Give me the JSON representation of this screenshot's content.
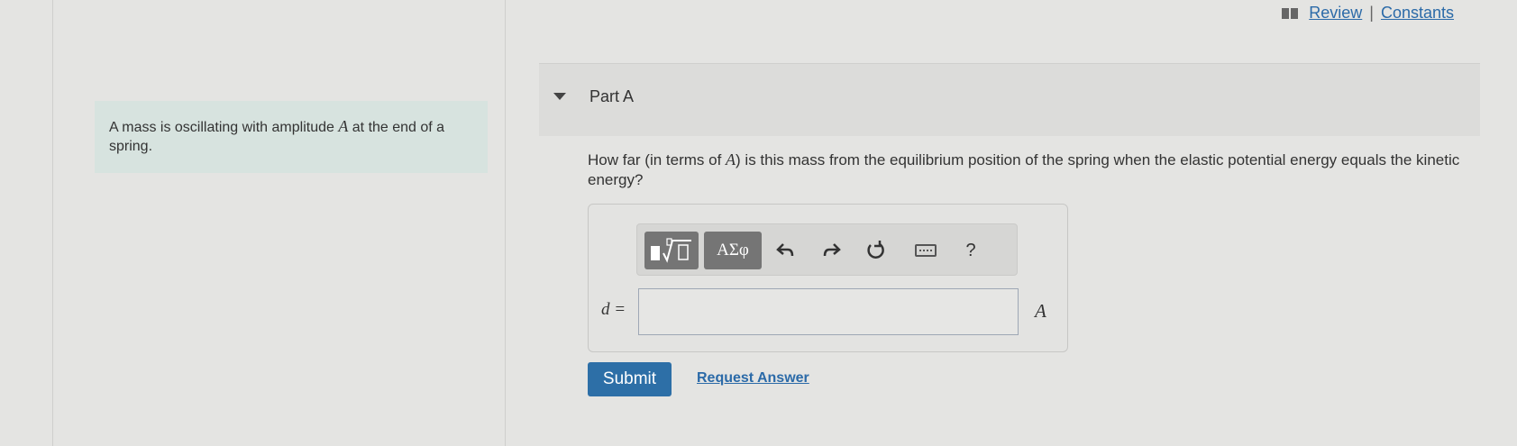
{
  "header": {
    "review_label": "Review",
    "separator": "|",
    "constants_label": "Constants"
  },
  "problem": {
    "text_before": "A mass is oscillating with amplitude ",
    "variable": "A",
    "text_after": " at the end of a spring."
  },
  "part": {
    "title": "Part A",
    "question_before": "How far (in terms of ",
    "question_variable": "A",
    "question_after": ") is this mass from the equilibrium position of the spring when the elastic potential energy equals the kinetic energy?"
  },
  "toolbar": {
    "templates_icon": "template-sqrt-icon",
    "greek_label": "ΑΣφ",
    "undo_icon": "undo-icon",
    "redo_icon": "redo-icon",
    "reset_icon": "reset-icon",
    "keyboard_icon": "keyboard-icon",
    "help_label": "?"
  },
  "answer": {
    "label": "d =",
    "value": "",
    "unit": "A"
  },
  "actions": {
    "submit_label": "Submit",
    "request_answer_label": "Request Answer"
  },
  "colors": {
    "accent": "#2d6fa7",
    "link": "#2b6aa8",
    "problem_bg": "#d7e3df"
  }
}
